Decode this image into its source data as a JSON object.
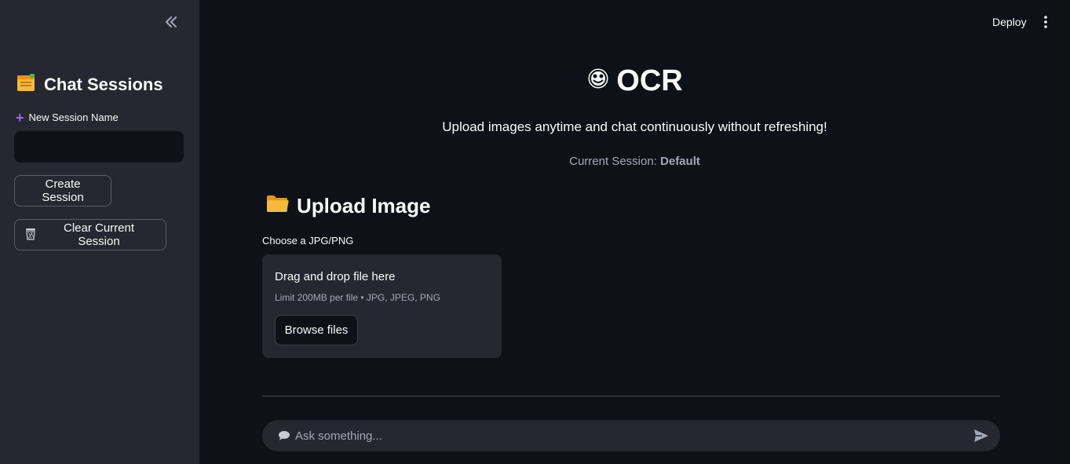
{
  "header": {
    "deploy_label": "Deploy"
  },
  "sidebar": {
    "title": "Chat Sessions",
    "new_session_label": "New Session Name",
    "new_session_value": "",
    "create_button_label": "Create Session",
    "clear_button_label": "Clear Current Session"
  },
  "main": {
    "title": "OCR",
    "subtitle": "Upload images anytime and chat continuously without refreshing!",
    "session_prefix": "Current Session:",
    "session_name": "Default",
    "upload_heading": "Upload Image",
    "choose_label": "Choose a JPG/PNG",
    "dropzone_title": "Drag and drop file here",
    "dropzone_limit": "Limit 200MB per file • JPG, JPEG, PNG",
    "browse_label": "Browse files"
  },
  "chat": {
    "placeholder": "Ask something..."
  },
  "colors": {
    "background": "#0e1117",
    "sidebar": "#262730",
    "accent_plus": "#9c6ade",
    "folder": "#f6b93b"
  },
  "icons": [
    "collapse-sidebar-icon",
    "kebab-menu-icon",
    "clipboard-icon",
    "plus-icon",
    "wastebasket-icon",
    "smiley-icon",
    "folder-icon",
    "speech-bubble-icon",
    "send-icon"
  ]
}
